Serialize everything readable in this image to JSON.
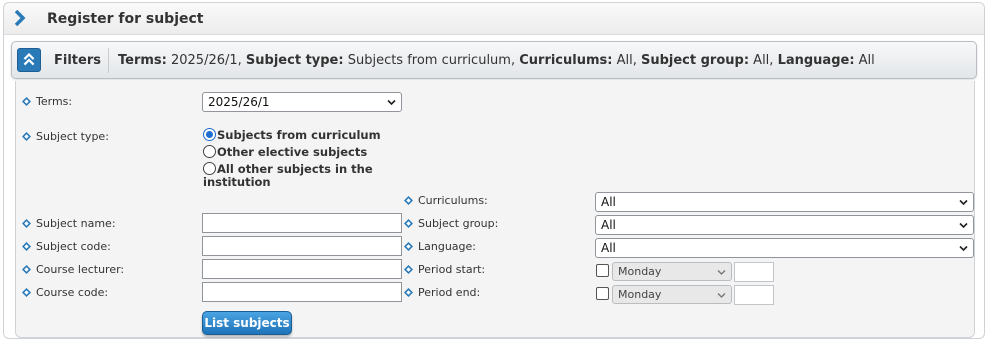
{
  "title": "Register for subject",
  "filters": {
    "label": "Filters",
    "summary": [
      {
        "key": "Terms:",
        "value": " 2025/26/1, "
      },
      {
        "key": "Subject type:",
        "value": " Subjects from curriculum, "
      },
      {
        "key": "Curriculums:",
        "value": " All, "
      },
      {
        "key": "Subject group:",
        "value": " All, "
      },
      {
        "key": "Language:",
        "value": " All"
      }
    ]
  },
  "form": {
    "terms_label": "Terms:",
    "terms_value": "2025/26/1",
    "subject_type_label": "Subject type:",
    "subject_type_options": [
      {
        "label": "Subjects from curriculum",
        "checked": true
      },
      {
        "label": "Other elective subjects",
        "checked": false
      },
      {
        "label": "All other subjects in the",
        "label2": "institution",
        "checked": false
      }
    ],
    "curriculums_label": "Curriculums:",
    "curriculums_value": "All",
    "subject_name_label": "Subject name:",
    "subject_group_label": "Subject group:",
    "subject_group_value": "All",
    "subject_code_label": "Subject code:",
    "language_label": "Language:",
    "language_value": "All",
    "course_lecturer_label": "Course lecturer:",
    "period_start_label": "Period start:",
    "period_start_day": "Monday",
    "course_code_label": "Course code:",
    "period_end_label": "Period end:",
    "period_end_day": "Monday",
    "list_button": "List subjects"
  },
  "colors": {
    "accent": "#2a7ab8",
    "bullet": "#2a7ab8",
    "radio_checked": "#1c6dd0"
  },
  "icons": {
    "title_chevron": "chevron-right-icon",
    "collapse": "double-chevron-up-icon",
    "bullet": "diamond-bullet-icon",
    "dropdown": "chevron-down-icon"
  }
}
